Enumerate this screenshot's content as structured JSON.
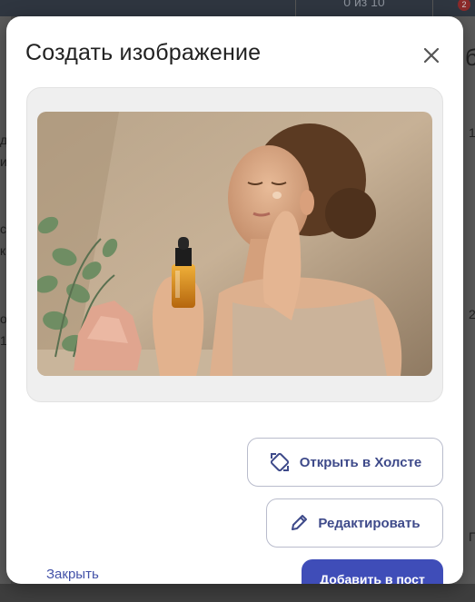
{
  "background": {
    "counter_text": "0 из 10",
    "badge_text": "2",
    "right_title_fragment": "б",
    "fragments": [
      "1",
      "2",
      "д",
      "и",
      "с",
      "к",
      "о",
      "1",
      "П"
    ]
  },
  "modal": {
    "title": "Создать изображение",
    "close_icon": "close-icon",
    "image_alt": "Женщина с флаконом сыворотки",
    "buttons": {
      "open_canvas": "Открыть в Холсте",
      "edit": "Редактировать",
      "close": "Закрыть",
      "add_to_post": "Добавить в пост"
    }
  },
  "colors": {
    "accent": "#3f4db8",
    "outline_text": "#3e4a8a",
    "link": "#4352a8"
  }
}
